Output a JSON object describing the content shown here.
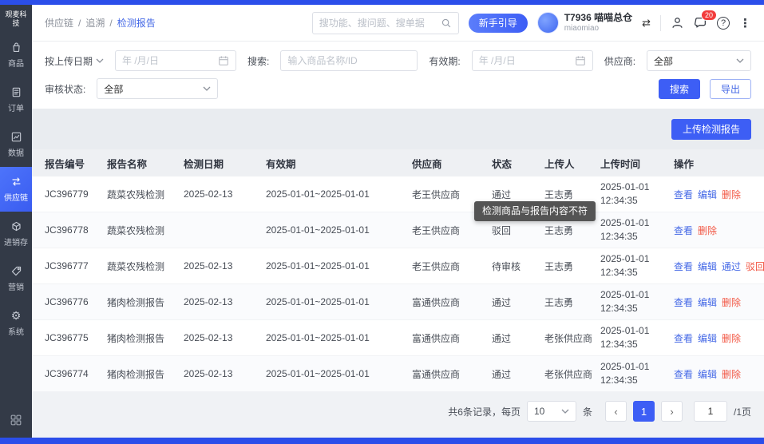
{
  "colors": {
    "primary": "#3d5ef5",
    "sidebar_bg": "#333a47",
    "sidebar_active": "#4165f6",
    "link_blue": "#4468e6",
    "danger_red": "#f25643",
    "edge_strip": "#2b4eea"
  },
  "sidebar": {
    "logo": "观麦科技",
    "items": [
      {
        "label": "商品"
      },
      {
        "label": "订单"
      },
      {
        "label": "数据"
      },
      {
        "label": "供应链"
      },
      {
        "label": "进销存"
      },
      {
        "label": "营销"
      },
      {
        "label": "系统"
      }
    ]
  },
  "header": {
    "breadcrumb": [
      "供应链",
      "追溯",
      "检测报告"
    ],
    "search_placeholder": "搜功能、搜问题、搜单据",
    "guide_button": "新手引导",
    "store_code": "T7936 喵喵总仓",
    "store_name": "miaomiao",
    "message_badge": "20",
    "swap_glyph": "⇄",
    "help_glyph": "?",
    "more_glyph": "⋮"
  },
  "filters": {
    "date_field_label": "按上传日期",
    "date_placeholder": "年 /月/日",
    "search_label": "搜索:",
    "search_placeholder": "输入商品名称/ID",
    "validity_label": "有效期:",
    "validity_placeholder": "年 /月/日",
    "supplier_label": "供应商:",
    "supplier_value": "全部",
    "status_label": "审核状态:",
    "status_value": "全部",
    "search_button": "搜索",
    "export_button": "导出"
  },
  "toolbar": {
    "upload_button": "上传检测报告"
  },
  "table": {
    "columns": [
      "报告编号",
      "报告名称",
      "检测日期",
      "有效期",
      "供应商",
      "状态",
      "上传人",
      "上传时间",
      "操作"
    ],
    "rows": [
      {
        "id": "JC396779",
        "name": "蔬菜农残检测",
        "date": "2025-02-13",
        "validity": "2025-01-01~2025-01-01",
        "supplier": "老王供应商",
        "status": "通过",
        "uploader": "王志勇",
        "time": "2025-01-01 12:34:35",
        "actions": [
          {
            "label": "查看",
            "color": "blue"
          },
          {
            "label": "编辑",
            "color": "blue"
          },
          {
            "label": "删除",
            "color": "red"
          }
        ]
      },
      {
        "id": "JC396778",
        "name": "蔬菜农残检测",
        "date": "",
        "validity": "2025-01-01~2025-01-01",
        "supplier": "老王供应商",
        "status": "驳回",
        "uploader": "王志勇",
        "time": "2025-01-01 12:34:35",
        "actions": [
          {
            "label": "查看",
            "color": "blue"
          },
          {
            "label": "删除",
            "color": "red"
          }
        ]
      },
      {
        "id": "JC396777",
        "name": "蔬菜农残检测",
        "date": "2025-02-13",
        "validity": "2025-01-01~2025-01-01",
        "supplier": "老王供应商",
        "status": "待审核",
        "uploader": "王志勇",
        "time": "2025-01-01 12:34:35",
        "actions": [
          {
            "label": "查看",
            "color": "blue"
          },
          {
            "label": "编辑",
            "color": "blue"
          },
          {
            "label": "通过",
            "color": "blue"
          },
          {
            "label": "驳回",
            "color": "red"
          }
        ]
      },
      {
        "id": "JC396776",
        "name": "猪肉检测报告",
        "date": "2025-02-13",
        "validity": "2025-01-01~2025-01-01",
        "supplier": "富通供应商",
        "status": "通过",
        "uploader": "王志勇",
        "time": "2025-01-01 12:34:35",
        "actions": [
          {
            "label": "查看",
            "color": "blue"
          },
          {
            "label": "编辑",
            "color": "blue"
          },
          {
            "label": "删除",
            "color": "red"
          }
        ]
      },
      {
        "id": "JC396775",
        "name": "猪肉检测报告",
        "date": "2025-02-13",
        "validity": "2025-01-01~2025-01-01",
        "supplier": "富通供应商",
        "status": "通过",
        "uploader": "老张供应商",
        "time": "2025-01-01 12:34:35",
        "actions": [
          {
            "label": "查看",
            "color": "blue"
          },
          {
            "label": "编辑",
            "color": "blue"
          },
          {
            "label": "删除",
            "color": "red"
          }
        ]
      },
      {
        "id": "JC396774",
        "name": "猪肉检测报告",
        "date": "2025-02-13",
        "validity": "2025-01-01~2025-01-01",
        "supplier": "富通供应商",
        "status": "通过",
        "uploader": "老张供应商",
        "time": "2025-01-01 12:34:35",
        "actions": [
          {
            "label": "查看",
            "color": "blue"
          },
          {
            "label": "编辑",
            "color": "blue"
          },
          {
            "label": "删除",
            "color": "red"
          }
        ]
      }
    ]
  },
  "tooltip": {
    "text": "检测商品与报告内容不符"
  },
  "pagination": {
    "summary": "共6条记录，每页",
    "page_size": "10",
    "unit": "条",
    "prev": "‹",
    "next": "›",
    "current_page": "1",
    "jump_value": "1",
    "total_label": "/1页"
  }
}
